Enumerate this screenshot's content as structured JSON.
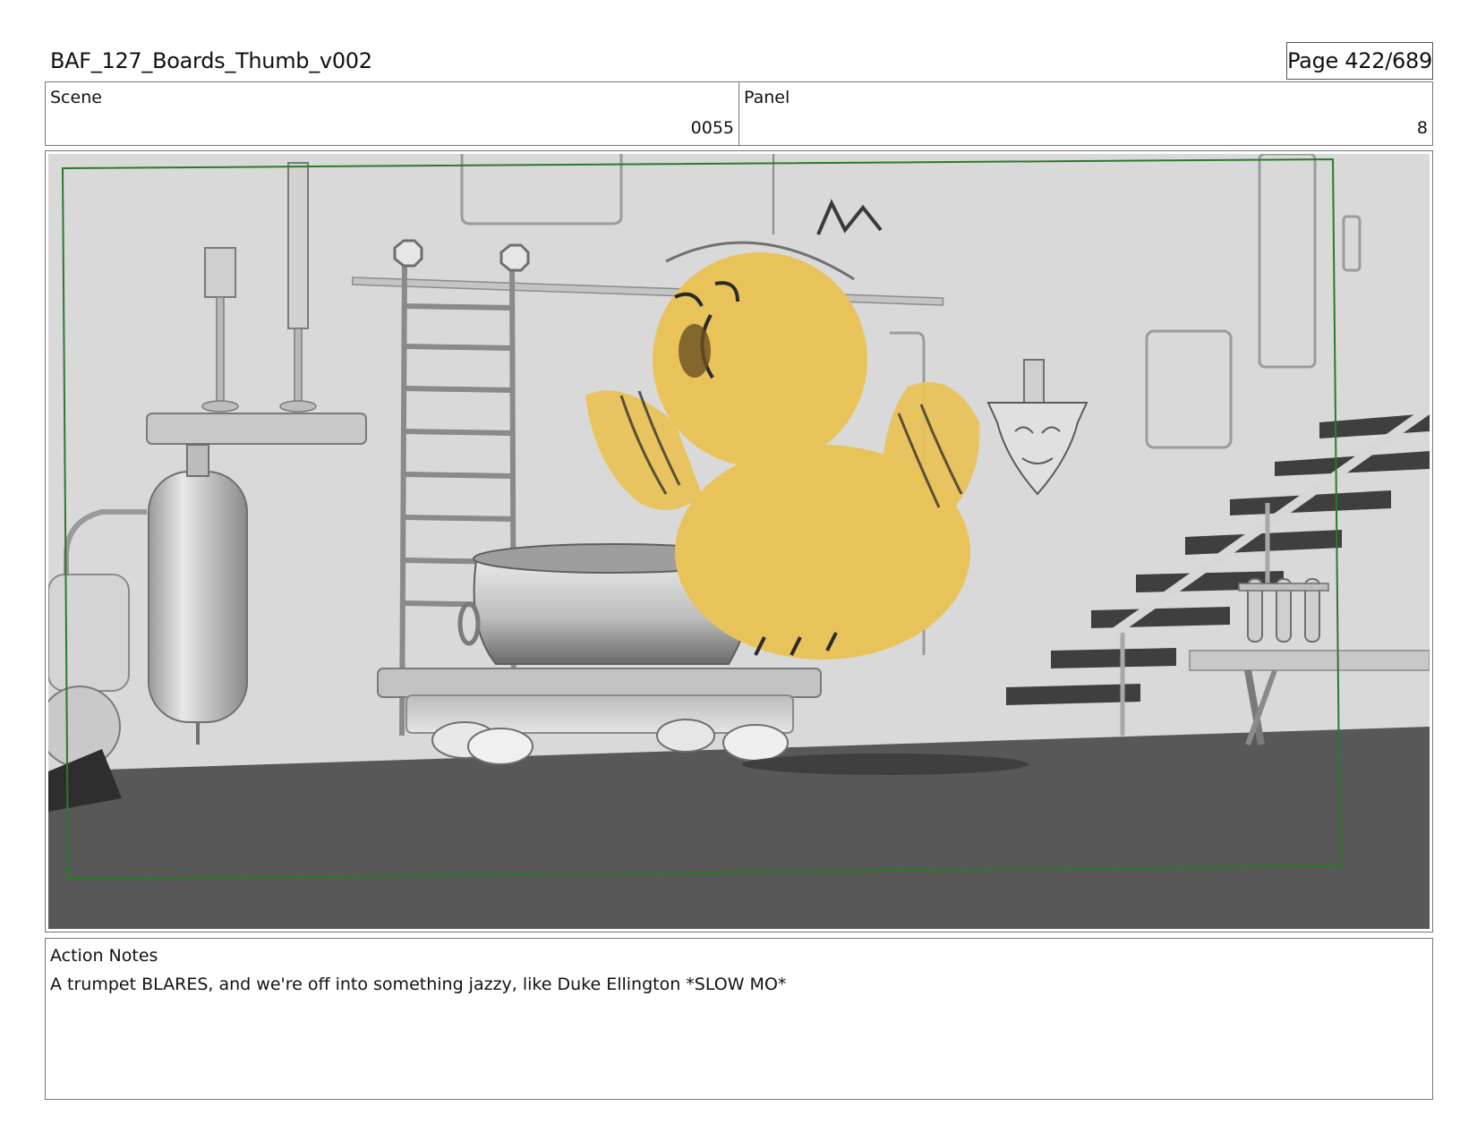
{
  "document": {
    "title": "BAF_127_Boards_Thumb_v002",
    "page": "Page 422/689"
  },
  "scene": {
    "label": "Scene",
    "value": "0055"
  },
  "panel": {
    "label": "Panel",
    "value": "8"
  },
  "artwork": {
    "description_icon": "storyboard-frame-image",
    "colors": {
      "wall": "#d9d9d9",
      "floor": "#585858",
      "bird": "#e8c35a",
      "safe_frame": "#2a7a2a"
    }
  },
  "notes": {
    "label": "Action Notes",
    "text": "A trumpet BLARES, and we're off into something jazzy, like Duke Ellington *SLOW MO*"
  }
}
